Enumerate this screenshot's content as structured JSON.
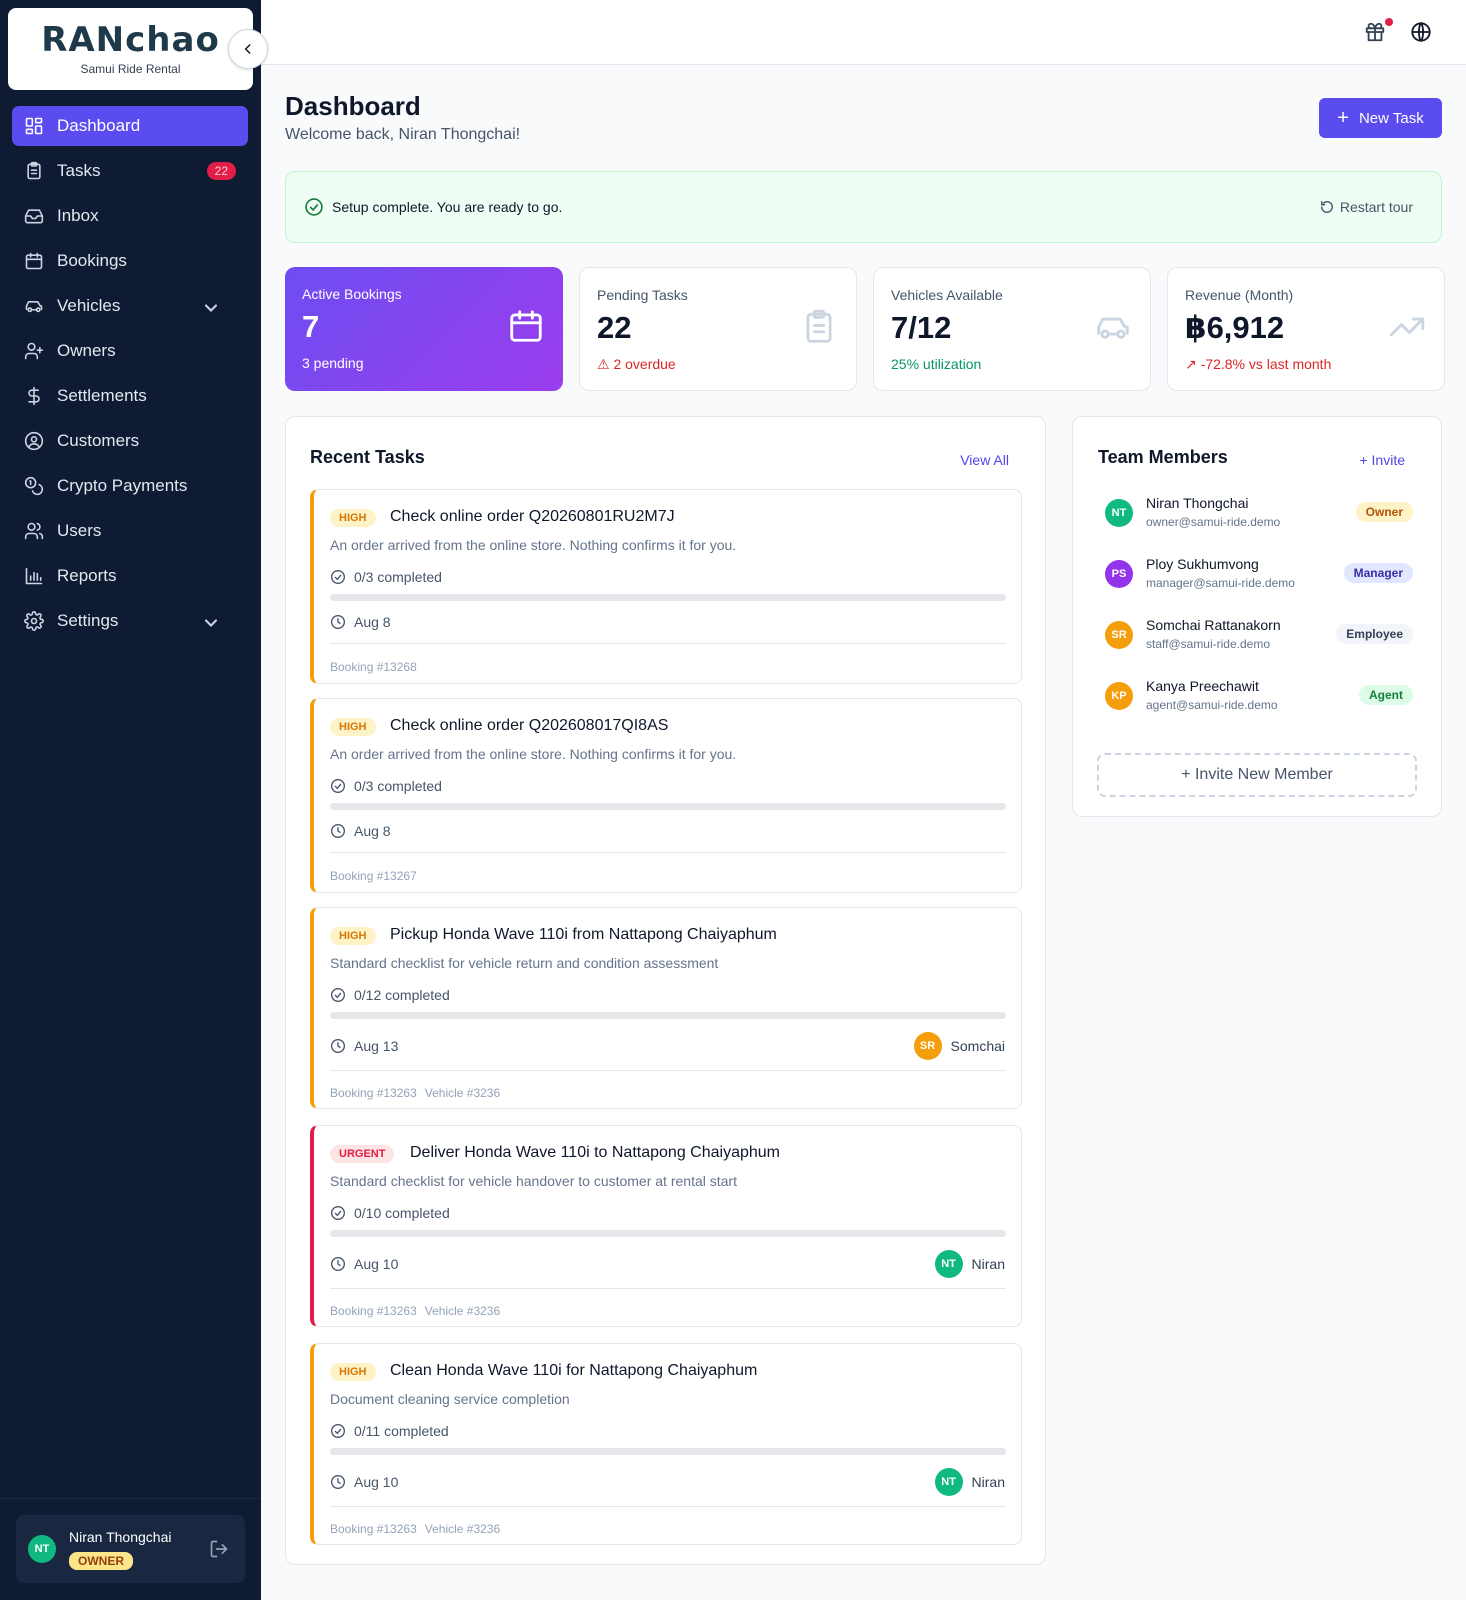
{
  "brand": {
    "logo": "RANchao",
    "subtitle": "Samui Ride Rental"
  },
  "sidebar": {
    "items": [
      {
        "label": "Dashboard",
        "icon": "dashboard-icon",
        "active": true
      },
      {
        "label": "Tasks",
        "icon": "clipboard-icon",
        "badge": "22"
      },
      {
        "label": "Inbox",
        "icon": "inbox-icon"
      },
      {
        "label": "Bookings",
        "icon": "calendar-icon"
      },
      {
        "label": "Vehicles",
        "icon": "car-icon",
        "expandable": true
      },
      {
        "label": "Owners",
        "icon": "owner-icon"
      },
      {
        "label": "Settlements",
        "icon": "dollar-icon"
      },
      {
        "label": "Customers",
        "icon": "user-circle-icon"
      },
      {
        "label": "Crypto Payments",
        "icon": "coins-icon"
      },
      {
        "label": "Users",
        "icon": "users-icon"
      },
      {
        "label": "Reports",
        "icon": "bar-chart-icon"
      },
      {
        "label": "Settings",
        "icon": "gear-icon",
        "expandable": true
      }
    ],
    "user": {
      "initials": "NT",
      "name": "Niran Thongchai",
      "role": "OWNER"
    }
  },
  "header": {
    "title": "Dashboard",
    "welcome": "Welcome back, Niran Thongchai!",
    "new_task": "New Task"
  },
  "setup": {
    "message": "Setup complete. You are ready to go.",
    "restart": "Restart tour"
  },
  "stats": [
    {
      "label": "Active Bookings",
      "value": "7",
      "foot": "3 pending",
      "icon": "calendar-icon"
    },
    {
      "label": "Pending Tasks",
      "value": "22",
      "foot": "2 overdue",
      "icon": "clipboard-icon",
      "foot_color": "#dc2626"
    },
    {
      "label": "Vehicles Available",
      "value": "7/12",
      "foot": "25% utilization",
      "icon": "car-icon",
      "foot_color": "#059669"
    },
    {
      "label": "Revenue (Month)",
      "value": "฿6,912",
      "foot": "-72.8% vs last month",
      "icon": "trending-up-icon",
      "foot_color": "#dc2626"
    }
  ],
  "recent_tasks": {
    "title": "Recent Tasks",
    "view_all": "View All",
    "items": [
      {
        "priority": "HIGH",
        "title": "Check online order Q20260801RU2M7J",
        "desc": "An order arrived from the online store. Nothing confirms it for you.",
        "progress": "0/3 completed",
        "progress_value": 0,
        "date": "Aug 8",
        "refs": [
          "Booking #13268"
        ]
      },
      {
        "priority": "HIGH",
        "title": "Check online order Q202608017QI8AS",
        "desc": "An order arrived from the online store. Nothing confirms it for you.",
        "progress": "0/3 completed",
        "progress_value": 0,
        "date": "Aug 8",
        "refs": [
          "Booking #13267"
        ]
      },
      {
        "priority": "HIGH",
        "title": "Pickup Honda Wave 110i from Nattapong Chaiyaphum",
        "desc": "Standard checklist for vehicle return and condition assessment",
        "progress": "0/12 completed",
        "progress_value": 0,
        "date": "Aug 13",
        "assignee": {
          "initials": "SR",
          "name": "Somchai",
          "color": "#f59e0b"
        },
        "refs": [
          "Booking #13263",
          "Vehicle #3236"
        ]
      },
      {
        "priority": "URGENT",
        "title": "Deliver Honda Wave 110i to Nattapong Chaiyaphum",
        "desc": "Standard checklist for vehicle handover to customer at rental start",
        "progress": "0/10 completed",
        "progress_value": 0,
        "date": "Aug 10",
        "assignee": {
          "initials": "NT",
          "name": "Niran",
          "color": "#10b981"
        },
        "refs": [
          "Booking #13263",
          "Vehicle #3236"
        ]
      },
      {
        "priority": "HIGH",
        "title": "Clean Honda Wave 110i for Nattapong Chaiyaphum",
        "desc": "Document cleaning service completion",
        "progress": "0/11 completed",
        "progress_value": 0,
        "date": "Aug 10",
        "assignee": {
          "initials": "NT",
          "name": "Niran",
          "color": "#10b981"
        },
        "refs": [
          "Booking #13263",
          "Vehicle #3236"
        ]
      }
    ]
  },
  "team": {
    "title": "Team Members",
    "invite": "+ Invite",
    "invite_new": "+ Invite New Member",
    "members": [
      {
        "initials": "NT",
        "name": "Niran Thongchai",
        "email": "owner@samui-ride.demo",
        "role": "Owner",
        "avatar_color": "#10b981",
        "role_bg": "#fef3c7",
        "role_color": "#b45309"
      },
      {
        "initials": "PS",
        "name": "Ploy Sukhumvong",
        "email": "manager@samui-ride.demo",
        "role": "Manager",
        "avatar_color": "#9333ea",
        "role_bg": "#e0e7ff",
        "role_color": "#3730a3"
      },
      {
        "initials": "SR",
        "name": "Somchai Rattanakorn",
        "email": "staff@samui-ride.demo",
        "role": "Employee",
        "avatar_color": "#f59e0b",
        "role_bg": "#f1f5f9",
        "role_color": "#334155"
      },
      {
        "initials": "KP",
        "name": "Kanya Preechawit",
        "email": "agent@samui-ride.demo",
        "role": "Agent",
        "avatar_color": "#f59e0b",
        "role_bg": "#dcfce7",
        "role_color": "#15803d"
      }
    ]
  }
}
